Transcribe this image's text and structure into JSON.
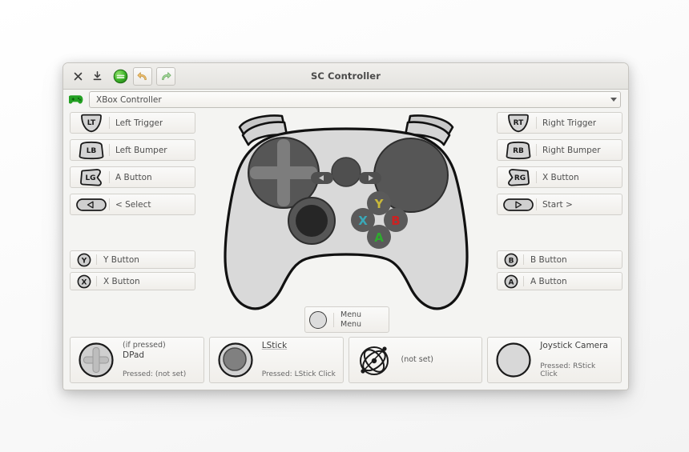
{
  "window": {
    "title": "SC Controller",
    "titlebar_icons": [
      {
        "name": "close-icon",
        "glyph": "×"
      },
      {
        "name": "save-icon",
        "glyph": "⤓"
      },
      {
        "name": "app-status-icon",
        "glyph": "≡"
      },
      {
        "name": "undo-icon",
        "glyph": "↶"
      },
      {
        "name": "redo-icon",
        "glyph": "↷"
      }
    ]
  },
  "profile": {
    "icon": "gamepad-icon",
    "value": "XBox Controller",
    "dropdown_icon": "chevron-down-icon"
  },
  "left_column": [
    {
      "code": "LT",
      "shape": "trigger",
      "label": "Left Trigger"
    },
    {
      "code": "LB",
      "shape": "bumper",
      "label": "Left Bumper"
    },
    {
      "code": "LG",
      "shape": "grip",
      "label": "A Button"
    },
    {
      "code": "◁",
      "shape": "pill",
      "label": "< Select"
    }
  ],
  "right_column": [
    {
      "code": "RT",
      "shape": "trigger",
      "label": "Right Trigger"
    },
    {
      "code": "RB",
      "shape": "bumper",
      "label": "Right Bumper"
    },
    {
      "code": "RG",
      "shape": "grip",
      "label": "X Button"
    },
    {
      "code": "▷",
      "shape": "pill",
      "label": "Start >"
    }
  ],
  "left_pair": [
    {
      "code": "Y",
      "label": "Y Button"
    },
    {
      "code": "X",
      "label": "X Button"
    }
  ],
  "right_pair": [
    {
      "code": "B",
      "label": "B Button"
    },
    {
      "code": "A",
      "label": "A Button"
    }
  ],
  "menu_box": {
    "line1": "Menu",
    "line2": "Menu"
  },
  "face_buttons": [
    {
      "code": "Y",
      "color": "#c9b83a"
    },
    {
      "code": "X",
      "color": "#3aa8b8"
    },
    {
      "code": "B",
      "color": "#cc2222"
    },
    {
      "code": "A",
      "color": "#2faa2f"
    }
  ],
  "panels": [
    {
      "art": "dpad-icon",
      "sub": "(if pressed)",
      "main": "DPad",
      "press": "Pressed: (not set)"
    },
    {
      "art": "lstick-icon",
      "sub": "",
      "main": "LStick",
      "press": "Pressed: LStick Click"
    },
    {
      "art": "gyro-icon",
      "sub": "",
      "main": "(not set)",
      "press": ""
    },
    {
      "art": "rstick-icon",
      "sub": "",
      "main": "Joystick Camera",
      "press": "Pressed: RStick Click"
    }
  ],
  "colors": {
    "window_bg": "#f4f4f2",
    "controller_body": "#d9d9d9",
    "trackpad": "#565656",
    "stick": "#2b2b2b",
    "accent_green": "#2f9e2f"
  }
}
